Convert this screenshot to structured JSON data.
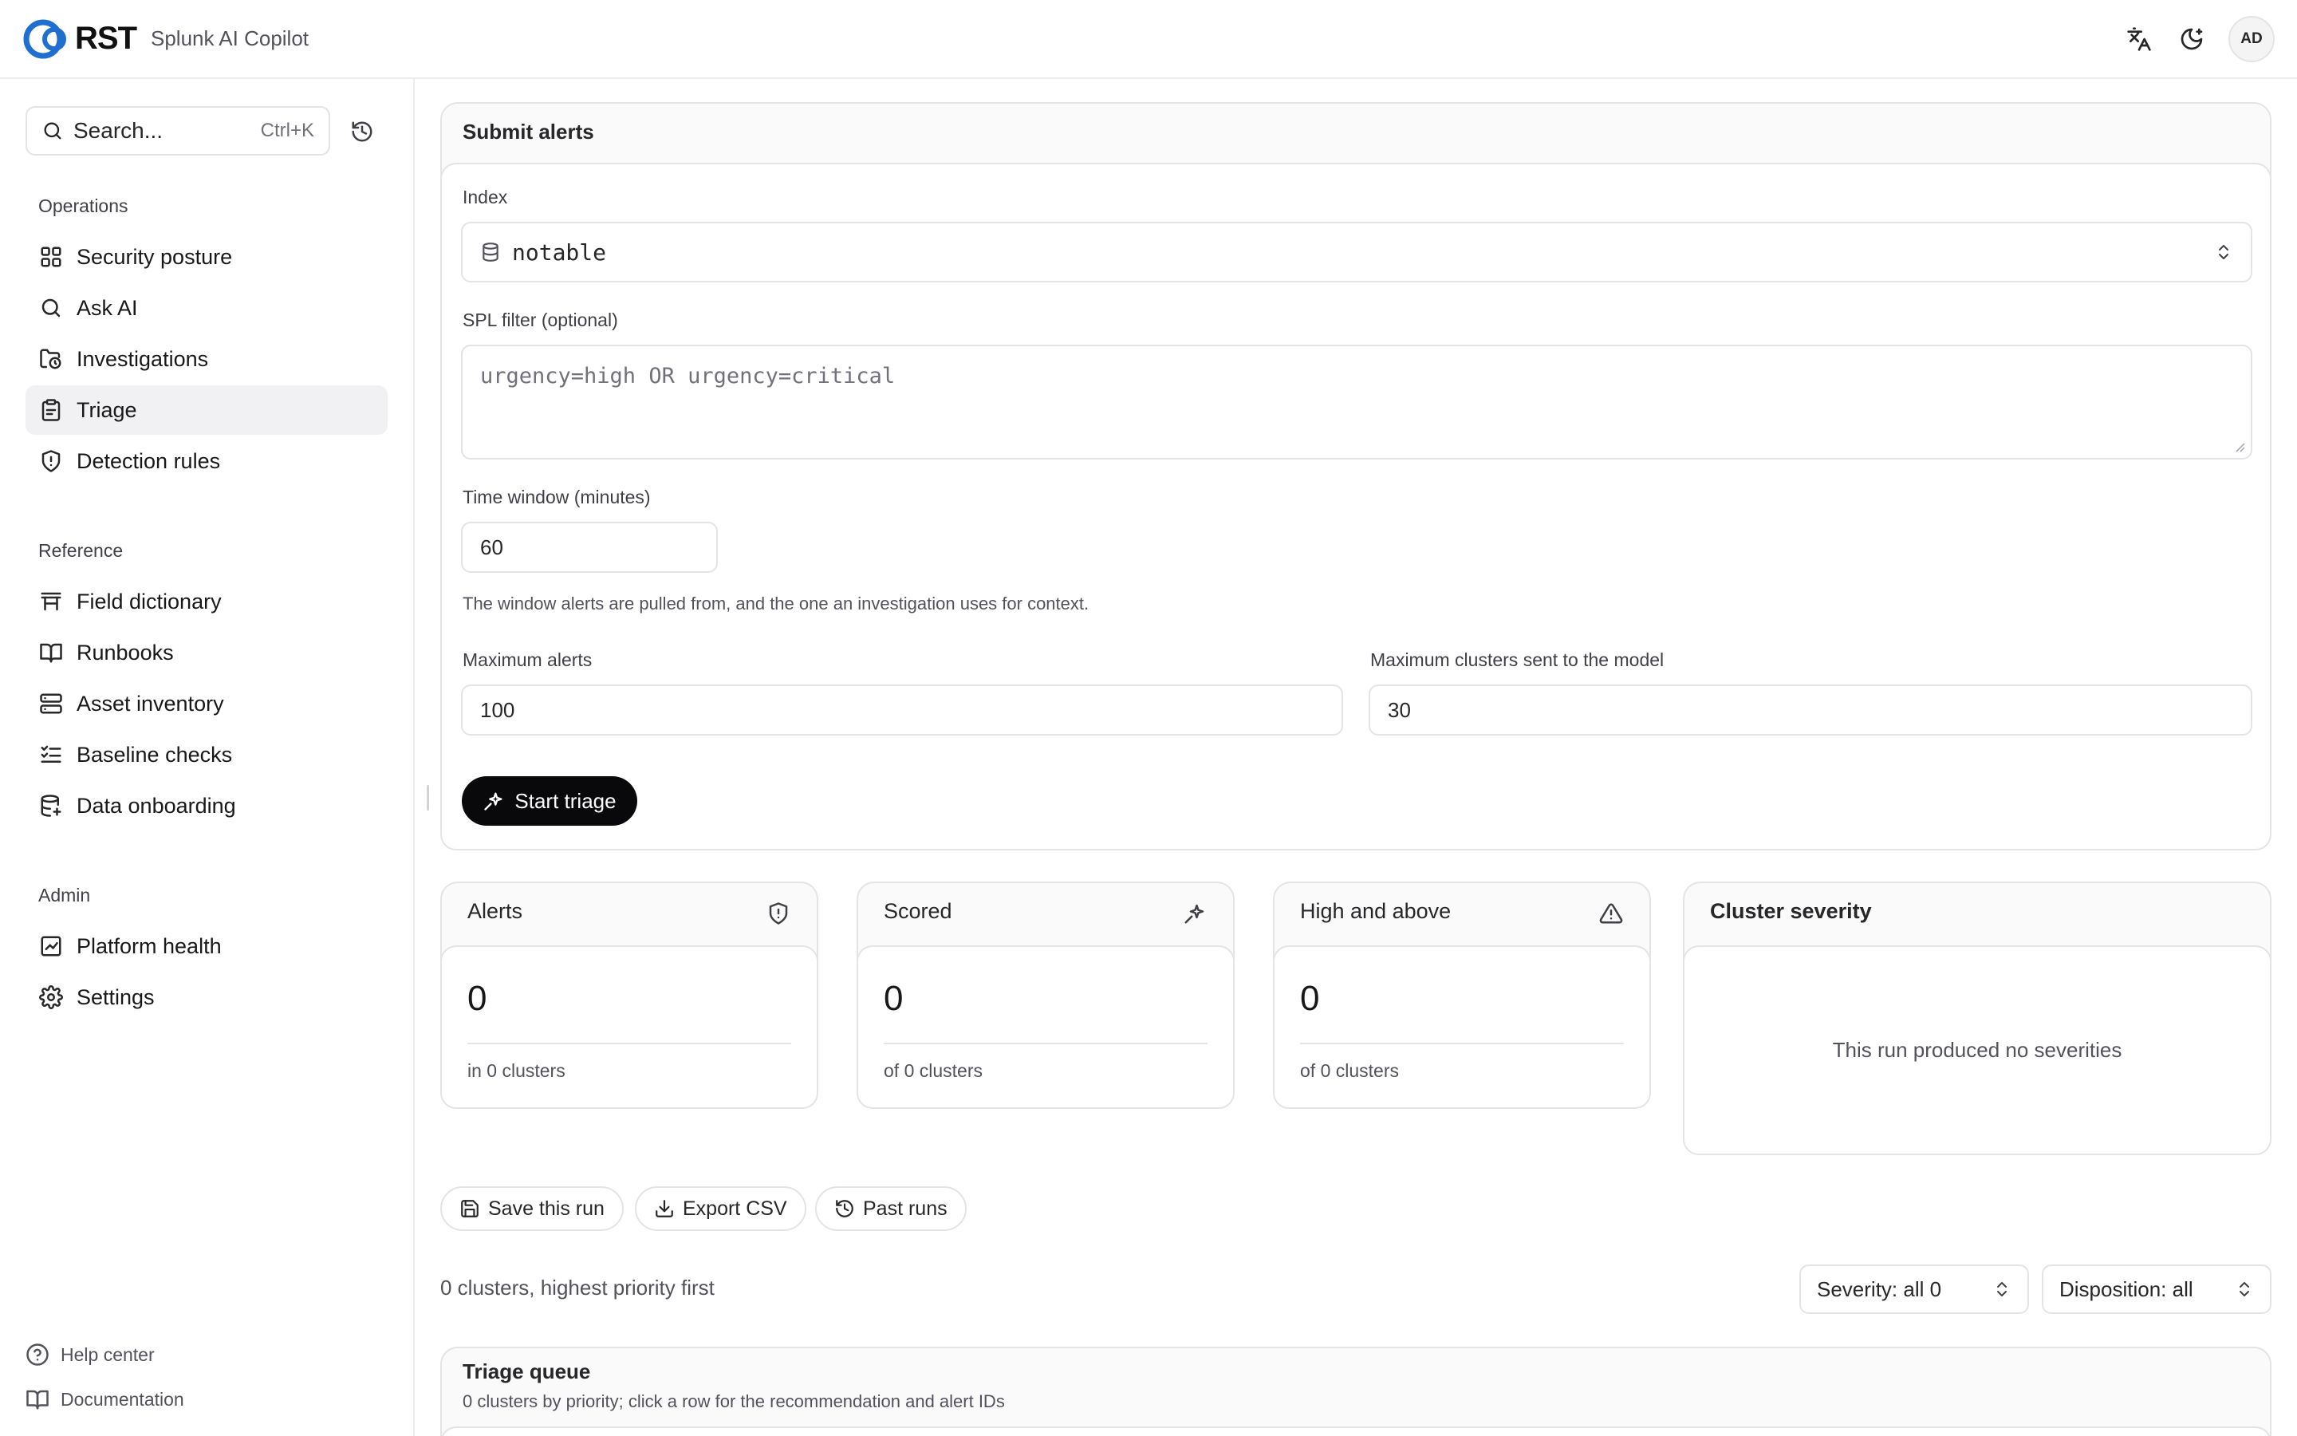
{
  "header": {
    "logo_text": "RST",
    "app_name": "Splunk AI Copilot",
    "avatar_initials": "AD",
    "icons": [
      "translate-icon",
      "moon-icon"
    ]
  },
  "sidebar": {
    "search": {
      "label": "Search...",
      "shortcut": "Ctrl+K"
    },
    "sections": [
      {
        "title": "Operations",
        "items": [
          {
            "label": "Security posture",
            "icon": "grid-icon"
          },
          {
            "label": "Ask AI",
            "icon": "search-icon"
          },
          {
            "label": "Investigations",
            "icon": "folder-clock-icon"
          },
          {
            "label": "Triage",
            "icon": "clipboard-icon",
            "active": true
          },
          {
            "label": "Detection rules",
            "icon": "shield-alert-icon"
          }
        ]
      },
      {
        "title": "Reference",
        "items": [
          {
            "label": "Field dictionary",
            "icon": "table-icon"
          },
          {
            "label": "Runbooks",
            "icon": "book-open-icon"
          },
          {
            "label": "Asset inventory",
            "icon": "server-icon"
          },
          {
            "label": "Baseline checks",
            "icon": "list-checks-icon"
          },
          {
            "label": "Data onboarding",
            "icon": "database-icon"
          }
        ]
      },
      {
        "title": "Admin",
        "items": [
          {
            "label": "Platform health",
            "icon": "chart-icon"
          },
          {
            "label": "Settings",
            "icon": "gear-icon"
          }
        ]
      }
    ],
    "footer": [
      {
        "label": "Help center",
        "icon": "help-circle-icon"
      },
      {
        "label": "Documentation",
        "icon": "book-icon"
      }
    ]
  },
  "submit": {
    "title": "Submit alerts",
    "index_label": "Index",
    "index_value": "notable",
    "spl_label": "SPL filter (optional)",
    "spl_placeholder": "urgency=high OR urgency=critical",
    "time_label": "Time window (minutes)",
    "time_value": "60",
    "time_hint": "The window alerts are pulled from, and the one an investigation uses for context.",
    "max_alerts_label": "Maximum alerts",
    "max_alerts_value": "100",
    "max_clusters_label": "Maximum clusters sent to the model",
    "max_clusters_value": "30",
    "start_button": "Start triage"
  },
  "stats": [
    {
      "title": "Alerts",
      "value": "0",
      "sub": "in 0 clusters",
      "icon": "shield-alert-icon"
    },
    {
      "title": "Scored",
      "value": "0",
      "sub": "of 0 clusters",
      "icon": "sparkles-icon"
    },
    {
      "title": "High and above",
      "value": "0",
      "sub": "of 0 clusters",
      "icon": "warning-triangle-icon"
    }
  ],
  "severity": {
    "title": "Cluster severity",
    "empty": "This run produced no severities"
  },
  "actions": {
    "save": "Save this run",
    "export": "Export CSV",
    "past": "Past runs"
  },
  "queue_summary": "0 clusters, highest priority first",
  "filters": {
    "severity": "Severity: all 0",
    "disposition": "Disposition: all"
  },
  "queue": {
    "title": "Triage queue",
    "subtitle": "0 clusters by priority; click a row for the recommendation and alert IDs"
  },
  "colors": {
    "brand_blue": "#1f6fd1",
    "primary_button": "#09090b",
    "active_nav": "#f1f1f3"
  }
}
